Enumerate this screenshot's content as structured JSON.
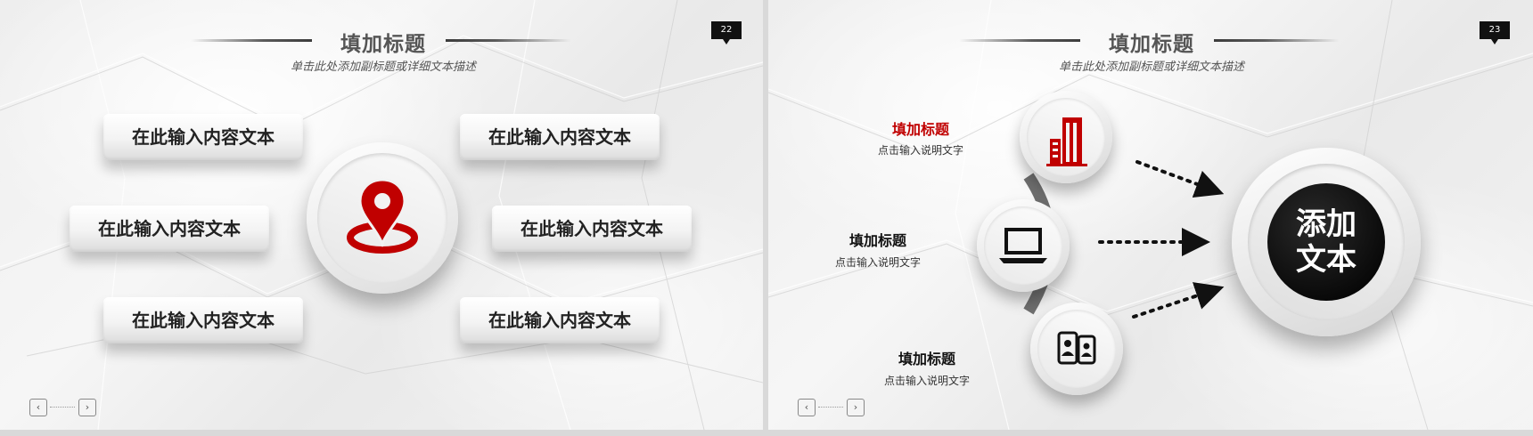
{
  "slides": [
    {
      "title": "填加标题",
      "subtitle": "单击此处添加副标题或详细文本描述",
      "page_number": "22",
      "boxes": [
        "在此输入内容文本",
        "在此输入内容文本",
        "在此输入内容文本",
        "在此输入内容文本",
        "在此输入内容文本",
        "在此输入内容文本"
      ],
      "center_icon": "location-pin-icon",
      "nav": {
        "prev_icon": "chevron-left-icon",
        "next_icon": "chevron-right-icon",
        "prev": "‹",
        "next": "›"
      }
    },
    {
      "title": "填加标题",
      "subtitle": "单击此处添加副标题或详细文本描述",
      "page_number": "23",
      "items": [
        {
          "title": "填加标题",
          "desc": "点击输入说明文字",
          "icon": "building-icon"
        },
        {
          "title": "填加标题",
          "desc": "点击输入说明文字",
          "icon": "laptop-icon"
        },
        {
          "title": "填加标题",
          "desc": "点击输入说明文字",
          "icon": "mobile-contacts-icon"
        }
      ],
      "core_text": [
        "添加",
        "文本"
      ],
      "nav": {
        "prev": "‹",
        "next": "›"
      }
    }
  ],
  "colors": {
    "accent": "#c00000",
    "dark": "#111111",
    "text": "#222222"
  }
}
